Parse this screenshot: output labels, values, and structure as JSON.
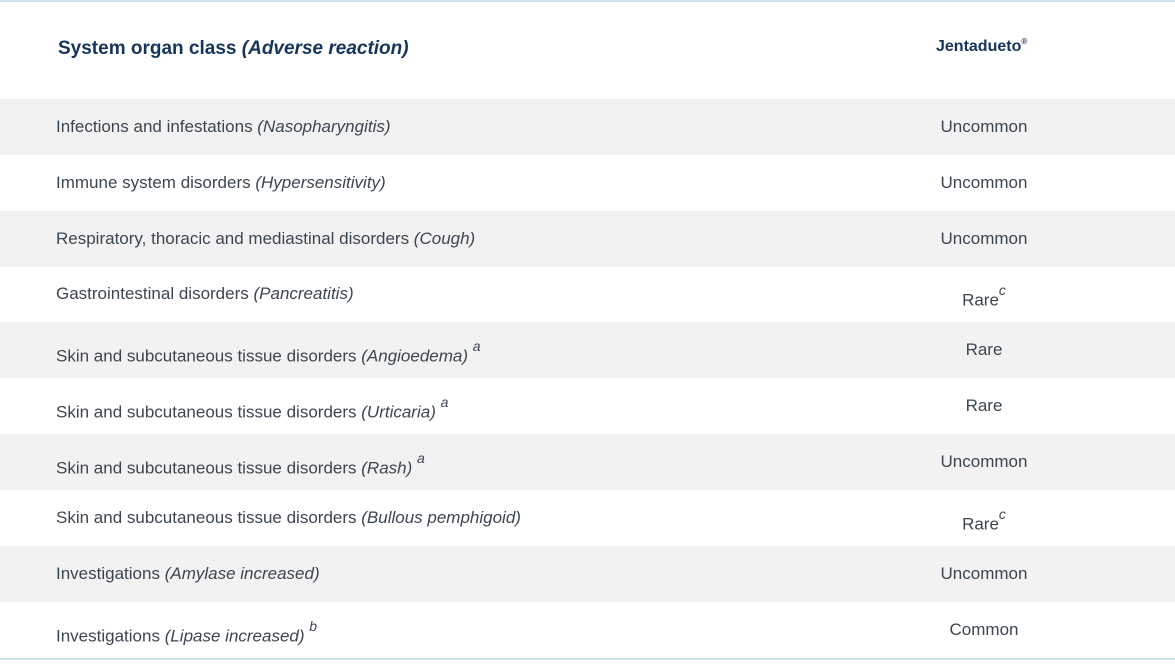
{
  "header": {
    "col1_main": "System organ class ",
    "col1_italic": "(Adverse reaction)",
    "col2_name": "Jentadueto",
    "col2_mark": "®"
  },
  "rows": [
    {
      "class": "Infections and infestations ",
      "reaction": "(Nasopharyngitis)",
      "note": "",
      "frequency": "Uncommon",
      "freq_note": ""
    },
    {
      "class": "Immune system disorders ",
      "reaction": "(Hypersensitivity)",
      "note": "",
      "frequency": "Uncommon",
      "freq_note": ""
    },
    {
      "class": "Respiratory, thoracic and mediastinal disorders ",
      "reaction": "(Cough)",
      "note": "",
      "frequency": "Uncommon",
      "freq_note": ""
    },
    {
      "class": "Gastrointestinal disorders ",
      "reaction": "(Pancreatitis)",
      "note": "",
      "frequency": "Rare",
      "freq_note": "c"
    },
    {
      "class": "Skin and subcutaneous tissue disorders ",
      "reaction": "(Angioedema)",
      "note": "a",
      "frequency": "Rare",
      "freq_note": ""
    },
    {
      "class": "Skin and subcutaneous tissue disorders ",
      "reaction": "(Urticaria)",
      "note": "a",
      "frequency": "Rare",
      "freq_note": ""
    },
    {
      "class": "Skin and subcutaneous tissue disorders ",
      "reaction": "(Rash)",
      "note": "a",
      "frequency": "Uncommon",
      "freq_note": ""
    },
    {
      "class": "Skin and subcutaneous tissue disorders ",
      "reaction": "(Bullous pemphigoid)",
      "note": "",
      "frequency": "Rare",
      "freq_note": "c"
    },
    {
      "class": "Investigations ",
      "reaction": "(Amylase increased)",
      "note": "",
      "frequency": "Uncommon",
      "freq_note": ""
    },
    {
      "class": "Investigations ",
      "reaction": "(Lipase increased)",
      "note": "b",
      "frequency": "Common",
      "freq_note": ""
    }
  ]
}
